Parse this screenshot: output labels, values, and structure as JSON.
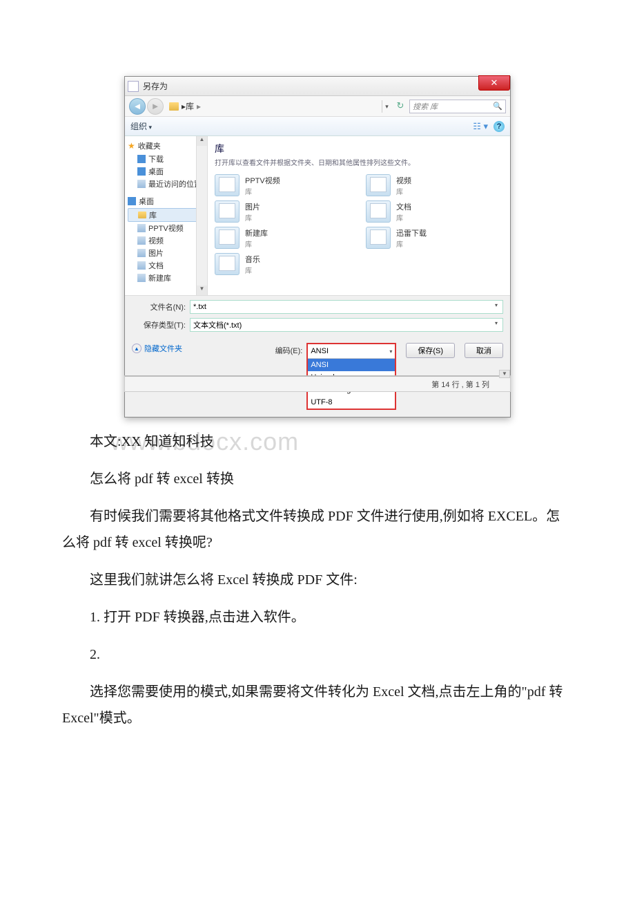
{
  "dialog": {
    "title": "另存为",
    "close_glyph": "✕",
    "breadcrumb_root": "库",
    "breadcrumb_sep": "▸",
    "search_placeholder": "搜索 库",
    "toolbar_organize": "组织",
    "main_heading": "库",
    "main_subtext": "打开库以查看文件并根据文件夹、日期和其他属性排列这些文件。",
    "sidebar": {
      "favorites": "收藏夹",
      "downloads": "下载",
      "desktop": "桌面",
      "recent": "最近访问的位置",
      "desktop2": "桌面",
      "libraries": "库",
      "pptv": "PPTV视频",
      "videos": "视频",
      "pictures": "图片",
      "documents": "文档",
      "newlib": "新建库"
    },
    "libs": {
      "pptv": "PPTV视频",
      "videos": "视频",
      "pictures": "图片",
      "documents": "文档",
      "newlib": "新建库",
      "xunlei": "迅雷下载",
      "music": "音乐",
      "sub": "库"
    },
    "filename_label": "文件名(N):",
    "filename_value": "*.txt",
    "filetype_label": "保存类型(T):",
    "filetype_value": "文本文档(*.txt)",
    "hide_folders": "隐藏文件夹",
    "encoding_label": "编码(E):",
    "encoding_selected": "ANSI",
    "encoding_options": [
      "ANSI",
      "Unicode",
      "Unicode big endian",
      "UTF-8"
    ],
    "save_btn": "保存(S)",
    "cancel_btn": "取消"
  },
  "statusbar": {
    "text": "第 14 行 , 第 1 列"
  },
  "watermark": "www.bdocx.com",
  "article": {
    "p1": "本文:XX 知道知科技",
    "p2": "怎么将 pdf 转 excel 转换",
    "p3": "有时候我们需要将其他格式文件转换成 PDF 文件进行使用,例如将 EXCEL。怎么将 pdf 转 excel 转换呢?",
    "p4": "这里我们就讲怎么将 Excel 转换成 PDF 文件:",
    "p5": "1. 打开 PDF 转换器,点击进入软件。",
    "p6": "2.",
    "p7": "选择您需要使用的模式,如果需要将文件转化为 Excel 文档,点击左上角的\"pdf 转 Excel\"模式。"
  }
}
